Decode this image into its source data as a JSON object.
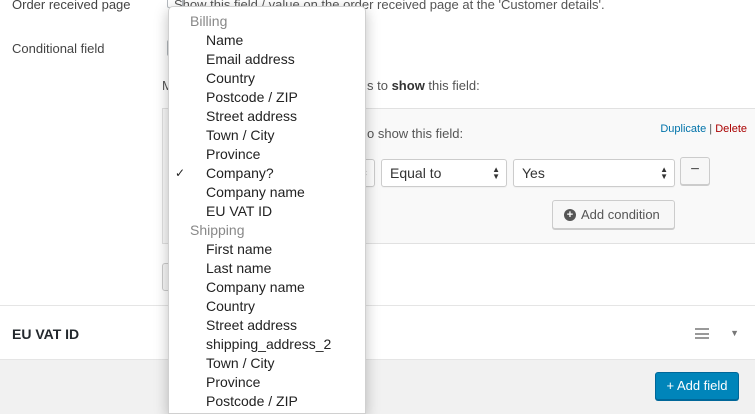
{
  "form": {
    "order_received_label": "Order received page",
    "order_received_desc": "Show this field / value on the order received page at the 'Customer details'.",
    "conditional_label": "Conditional field",
    "show_rule_prefix": "M",
    "show_rule_mid": "s to ",
    "show_rule_bold": "show",
    "show_rule_suffix": " this field:",
    "inner_rule_text": "o show this field:"
  },
  "rule": {
    "links": {
      "duplicate": "Duplicate",
      "separator": "|",
      "delete": "Delete"
    },
    "operator": "Equal to",
    "value": "Yes",
    "minus_label": "−",
    "add_condition_label": "Add condition",
    "add_condition_icon": "plus-circle-icon"
  },
  "vat_section": {
    "title": "EU VAT ID",
    "menu_icon": "hamburger-icon",
    "toggle_icon": "caret-down-icon"
  },
  "footer": {
    "add_field_label": "+ Add field"
  },
  "dropdown": {
    "groups": [
      {
        "label": "Billing",
        "items": [
          "Name",
          "Email address",
          "Country",
          "Postcode / ZIP",
          "Street address",
          "Town / City",
          "Province",
          "Company?",
          "Company name",
          "EU VAT ID"
        ]
      },
      {
        "label": "Shipping",
        "items": [
          "First name",
          "Last name",
          "Company name",
          "Country",
          "Street address",
          "shipping_address_2",
          "Town / City",
          "Province",
          "Postcode / ZIP"
        ]
      }
    ],
    "selected": "Company?",
    "check_mark": "✓"
  },
  "colors": {
    "primary": "#0085ba",
    "link": "#0073aa",
    "delete": "#aa0000"
  }
}
